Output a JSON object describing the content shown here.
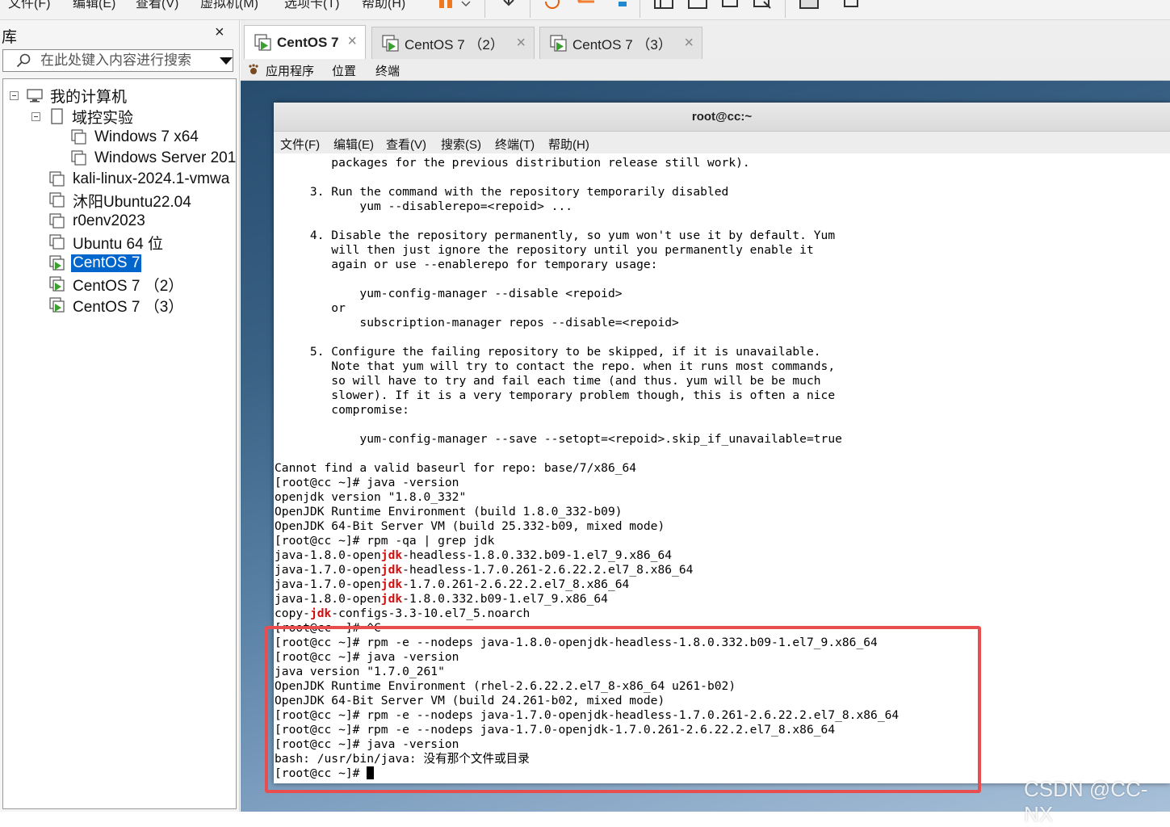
{
  "app": {
    "menu": [
      "文件(F)",
      "编辑(E)",
      "查看(V)",
      "虚拟机(M)",
      "选项卡(T)",
      "帮助(H)"
    ]
  },
  "library": {
    "title": "库",
    "close": "×",
    "search_placeholder": "在此处键入内容进行搜索",
    "tree": [
      {
        "label": "我的计算机",
        "icon": "computer-icon"
      },
      {
        "label": "域控实验",
        "icon": "folder-icon"
      },
      {
        "label": "Windows 7 x64",
        "icon": "vm-icon"
      },
      {
        "label": "Windows Server 201",
        "icon": "vm-icon"
      },
      {
        "label": "kali-linux-2024.1-vmwa",
        "icon": "vm-icon"
      },
      {
        "label": "沐阳Ubuntu22.04",
        "icon": "vm-icon"
      },
      {
        "label": "r0env2023",
        "icon": "vm-icon"
      },
      {
        "label": "Ubuntu 64 位",
        "icon": "vm-icon"
      },
      {
        "label": "CentOS 7",
        "icon": "vm-running-icon",
        "selected": true
      },
      {
        "label": "CentOS 7 （2）",
        "icon": "vm-running-icon"
      },
      {
        "label": "CentOS 7 （3）",
        "icon": "vm-running-icon"
      }
    ]
  },
  "tabs": [
    {
      "label": "CentOS 7",
      "active": true
    },
    {
      "label": "CentOS 7 （2）",
      "active": false
    },
    {
      "label": "CentOS 7 （3）",
      "active": false
    }
  ],
  "guest_panel": {
    "applications": "应用程序",
    "places": "位置",
    "terminal": "终端"
  },
  "terminal": {
    "title": "root@cc:~",
    "menu": [
      "文件(F)",
      "编辑(E)",
      "查看(V)",
      "搜索(S)",
      "终端(T)",
      "帮助(H)"
    ],
    "lines": [
      "        packages for the previous distribution release still work).",
      "",
      "     3. Run the command with the repository temporarily disabled",
      "            yum --disablerepo=<repoid> ...",
      "",
      "     4. Disable the repository permanently, so yum won't use it by default. Yum",
      "        will then just ignore the repository until you permanently enable it",
      "        again or use --enablerepo for temporary usage:",
      "",
      "            yum-config-manager --disable <repoid>",
      "        or",
      "            subscription-manager repos --disable=<repoid>",
      "",
      "     5. Configure the failing repository to be skipped, if it is unavailable.",
      "        Note that yum will try to contact the repo. when it runs most commands,",
      "        so will have to try and fail each time (and thus. yum will be be much",
      "        slower). If it is a very temporary problem though, this is often a nice",
      "        compromise:",
      "",
      "            yum-config-manager --save --setopt=<repoid>.skip_if_unavailable=true",
      "",
      "Cannot find a valid baseurl for repo: base/7/x86_64",
      "[root@cc ~]# java -version",
      "openjdk version \"1.8.0_332\"",
      "OpenJDK Runtime Environment (build 1.8.0_332-b09)",
      "OpenJDK 64-Bit Server VM (build 25.332-b09, mixed mode)",
      "[root@cc ~]# rpm -qa | grep jdk",
      "java-1.8.0-openjdk-headless-1.8.0.332.b09-1.el7_9.x86_64",
      "java-1.7.0-openjdk-headless-1.7.0.261-2.6.22.2.el7_8.x86_64",
      "java-1.7.0-openjdk-1.7.0.261-2.6.22.2.el7_8.x86_64",
      "java-1.8.0-openjdk-1.8.0.332.b09-1.el7_9.x86_64",
      "copy-jdk-configs-3.3-10.el7_5.noarch",
      "[root@cc ~]# ^C",
      "[root@cc ~]# rpm -e --nodeps java-1.8.0-openjdk-headless-1.8.0.332.b09-1.el7_9.x86_64",
      "[root@cc ~]# java -version",
      "java version \"1.7.0_261\"",
      "OpenJDK Runtime Environment (rhel-2.6.22.2.el7_8-x86_64 u261-b02)",
      "OpenJDK 64-Bit Server VM (build 24.261-b02, mixed mode)",
      "[root@cc ~]# rpm -e --nodeps java-1.7.0-openjdk-headless-1.7.0.261-2.6.22.2.el7_8.x86_64",
      "[root@cc ~]# rpm -e --nodeps java-1.7.0-openjdk-1.7.0.261-2.6.22.2.el7_8.x86_64",
      "[root@cc ~]# java -version",
      "bash: /usr/bin/java: 没有那个文件或目录",
      "[root@cc ~]# "
    ],
    "highlight": "jdk",
    "highlight_color": "#d01010"
  },
  "watermark": "CSDN @CC-NX",
  "colors": {
    "selection": "#0066cc",
    "annotation": "#e84e4e",
    "vm_running": "#3aa12e"
  }
}
